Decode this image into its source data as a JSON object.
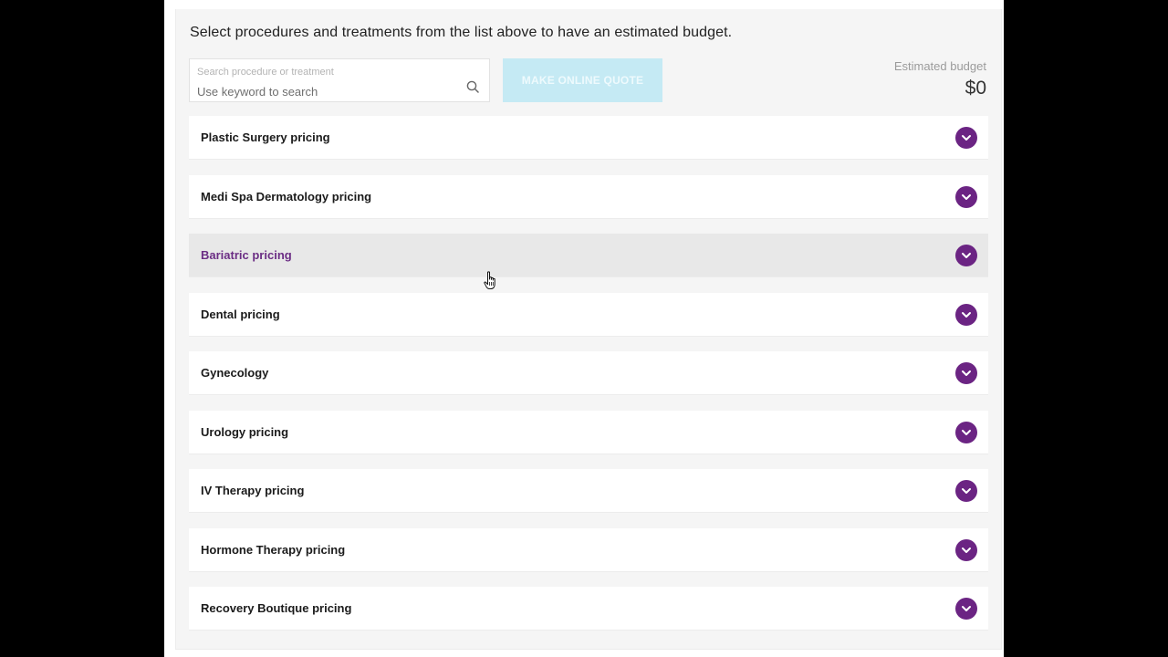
{
  "intro_text": "Select procedures and treatments from the list above to have an estimated budget.",
  "search": {
    "label": "Search procedure or treatment",
    "placeholder": "Use keyword to search",
    "icon": "search-icon"
  },
  "quote_button_label": "MAKE ONLINE QUOTE",
  "budget": {
    "label": "Estimated budget",
    "value": "$0"
  },
  "categories": [
    {
      "label": "Plastic Surgery pricing"
    },
    {
      "label": "Medi Spa Dermatology pricing"
    },
    {
      "label": "Bariatric pricing",
      "hovered": true
    },
    {
      "label": "Dental pricing"
    },
    {
      "label": "Gynecology"
    },
    {
      "label": "Urology pricing"
    },
    {
      "label": "IV Therapy pricing"
    },
    {
      "label": "Hormone Therapy pricing"
    },
    {
      "label": "Recovery Boutique pricing"
    }
  ],
  "colors": {
    "accent": "#6b2483",
    "hover_text": "#6b2d84",
    "button_disabled": "#c5eaf4",
    "row_hover_bg": "#e8e8e8"
  }
}
